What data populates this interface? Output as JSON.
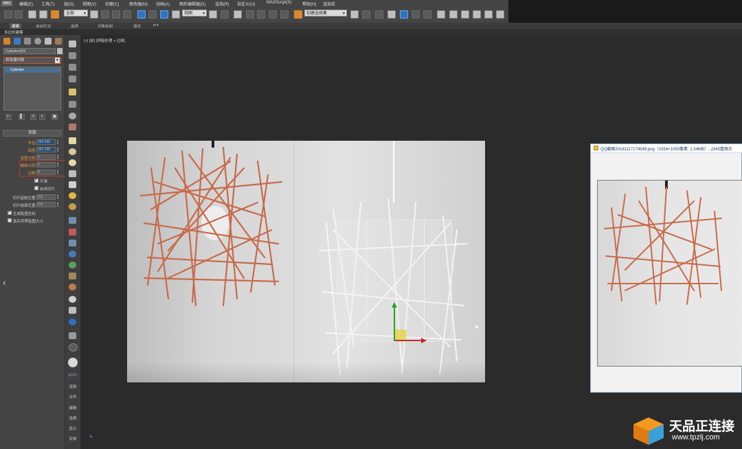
{
  "menu": {
    "logo": "MAX",
    "items": [
      "编辑(E)",
      "工具(T)",
      "组(G)",
      "视图(V)",
      "创建(C)",
      "修改器(M)",
      "动画(A)",
      "图形编辑器(D)",
      "渲染(R)",
      "自定义(U)",
      "MAXScript(X)",
      "帮助(H)",
      "渲染库"
    ]
  },
  "toolbar": {
    "selection_filter": "全部",
    "ref_coord": "视图",
    "named_selection": "创建选择集"
  },
  "ribbon": {
    "tabs": [
      "建模",
      "自由形式",
      "选择",
      "对象绘制",
      "填充"
    ],
    "subbar": "多边形建模"
  },
  "command_panel": {
    "object_name": "Cylinder002",
    "modifier_list": "修改器列表",
    "stack_item": "Cylinder",
    "rollout": "参数",
    "params": [
      {
        "label": "半径:",
        "value": "283.666",
        "highlight": true,
        "blue": true
      },
      {
        "label": "高度:",
        "value": "591.428",
        "highlight": true,
        "blue": true
      },
      {
        "label": "高度分段:",
        "value": "1",
        "highlight": true,
        "blue": false
      },
      {
        "label": "端面分段:",
        "value": "1",
        "highlight": true,
        "blue": false
      },
      {
        "label": "边数:",
        "value": "6",
        "highlight": true,
        "blue": false
      }
    ],
    "smooth": "平滑",
    "slice_on": "启用切片",
    "slice_from_label": "切片起始位置:",
    "slice_from": "0.0",
    "slice_to_label": "切片结束位置:",
    "slice_to": "0.0",
    "gen_mapping": "生成贴图坐标",
    "real_world": "真实世界贴图大小"
  },
  "strip": {
    "labels": [
      "EDIT",
      "渲染",
      "文件",
      "编辑",
      "选择",
      "显示",
      "实体"
    ]
  },
  "viewport": {
    "label": "[+] [前] [明暗处理 + 边面]"
  },
  "viewer": {
    "title": "QQ截图20181117174549.png（1554×1050像素, 1.54MB）- 2345看图王"
  },
  "watermark": {
    "brand": "天品正连接",
    "url": "www.tpzlj.com"
  }
}
